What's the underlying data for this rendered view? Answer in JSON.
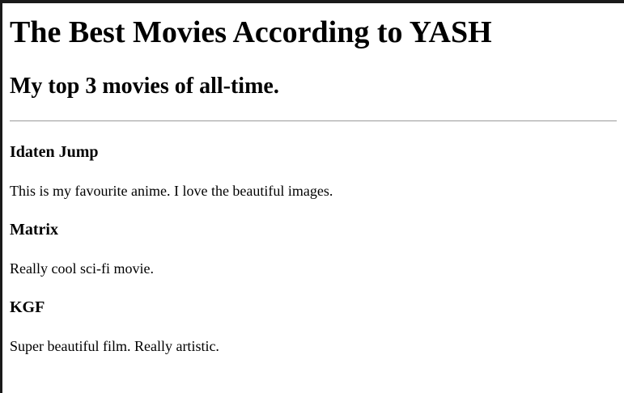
{
  "page": {
    "title": "The Best Movies According to YASH",
    "subtitle": "My top 3 movies of all-time."
  },
  "movies": [
    {
      "name": "Idaten Jump",
      "description": "This is my favourite anime. I love the beautiful images."
    },
    {
      "name": "Matrix",
      "description": "Really cool sci-fi movie."
    },
    {
      "name": "KGF",
      "description": "Super beautiful film. Really artistic."
    }
  ]
}
